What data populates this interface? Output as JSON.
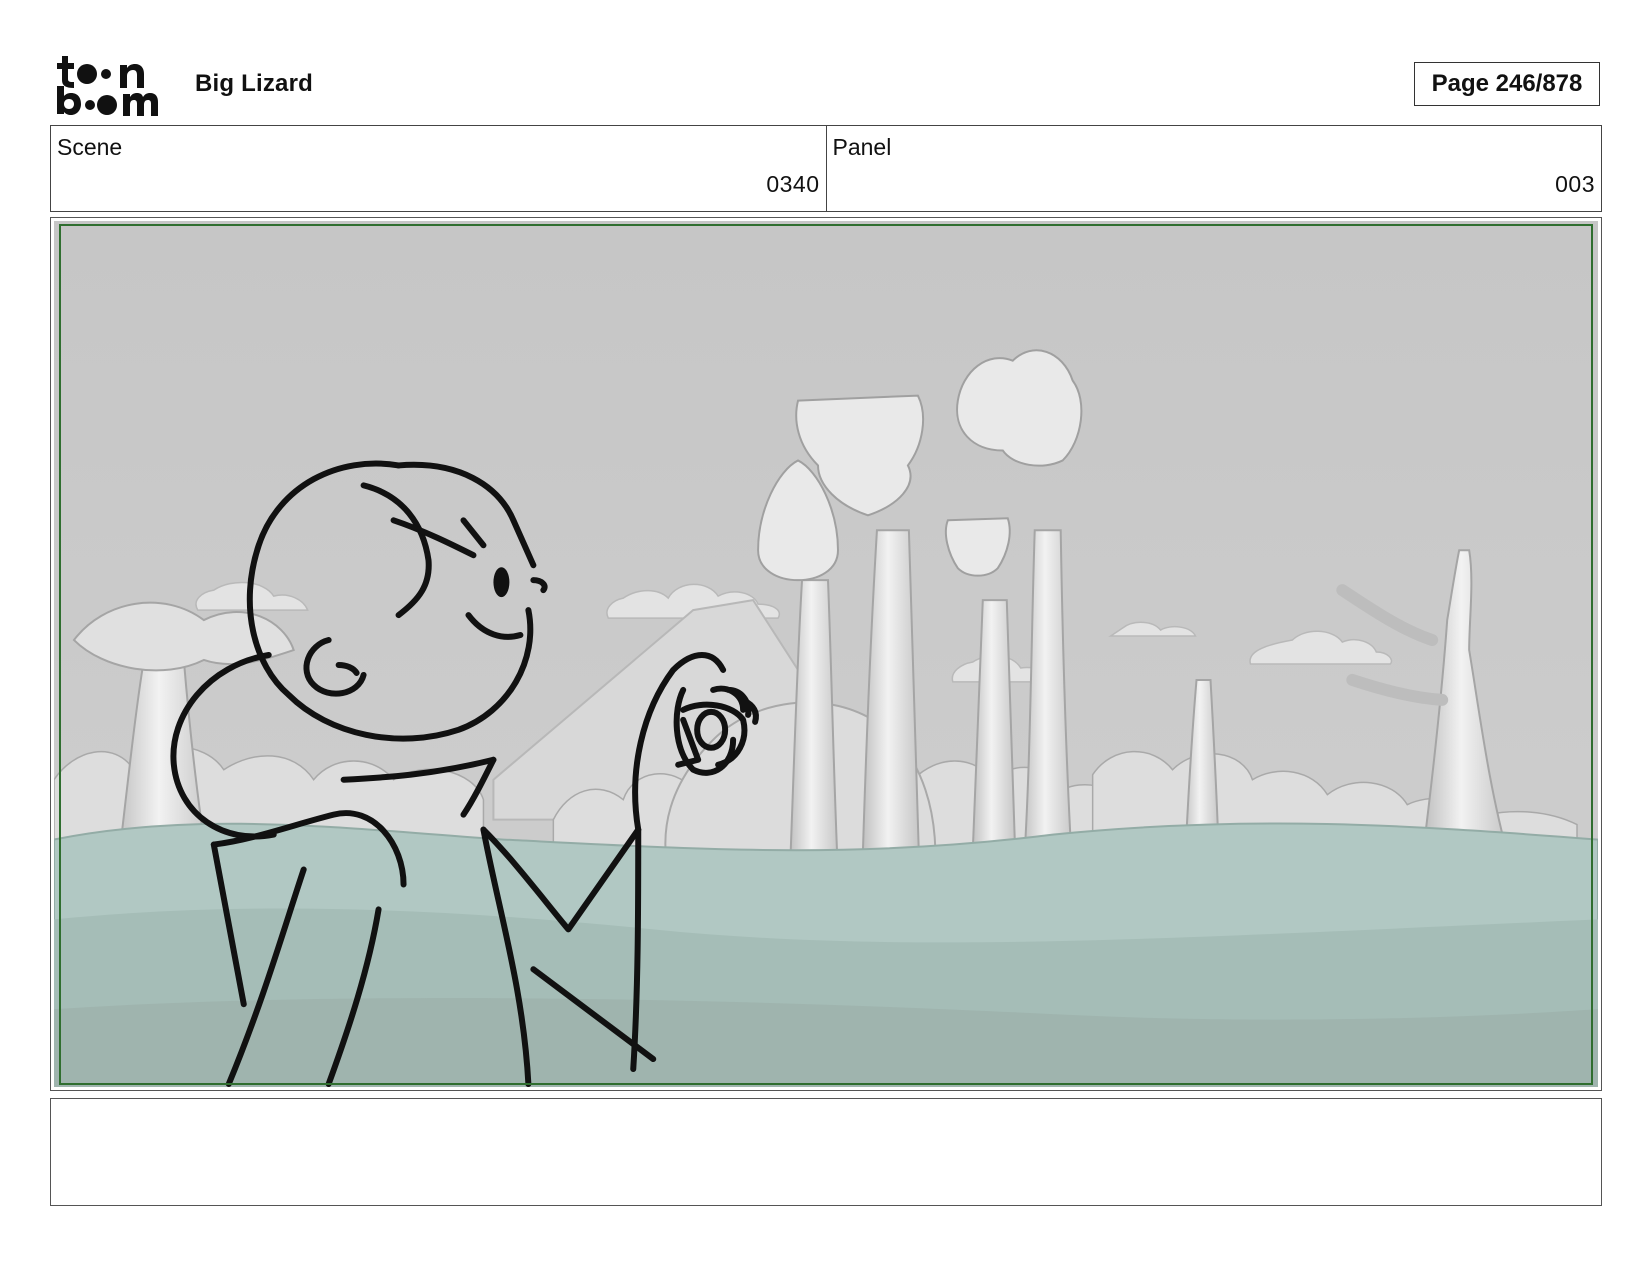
{
  "header": {
    "logo_text_top": "toon",
    "logo_text_bottom": "boom",
    "project_title": "Big Lizard",
    "page_label": "Page 246/878"
  },
  "info": {
    "scene_label": "Scene",
    "scene_value": "0340",
    "panel_label": "Panel",
    "panel_value": "003"
  },
  "panel": {
    "frame_color": "#2f6e2f",
    "background_color": "#c9c9c9",
    "ground_color": "#a9c4be"
  },
  "notes": {
    "text": ""
  }
}
